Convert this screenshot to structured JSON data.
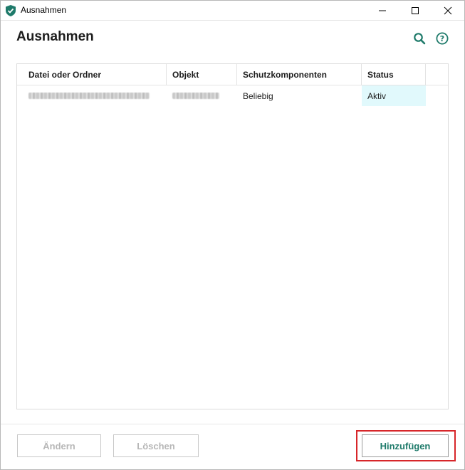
{
  "window": {
    "title": "Ausnahmen",
    "app_icon": "shield-check-icon",
    "controls": [
      "minimize-icon",
      "maximize-icon",
      "close-icon"
    ]
  },
  "header": {
    "title": "Ausnahmen",
    "icons": [
      "search-icon",
      "help-icon"
    ],
    "accent_color": "#1e7a6a"
  },
  "table": {
    "columns": [
      "Datei oder Ordner",
      "Objekt",
      "Schutzkomponenten",
      "Status"
    ],
    "rows": [
      {
        "file": "",
        "object": "",
        "components": "Beliebig",
        "status": "Aktiv"
      }
    ],
    "selected_cell_color": "#e1f9fc"
  },
  "footer": {
    "edit_label": "Ändern",
    "delete_label": "Löschen",
    "add_label": "Hinzufügen",
    "highlight_color": "#d7262a"
  }
}
